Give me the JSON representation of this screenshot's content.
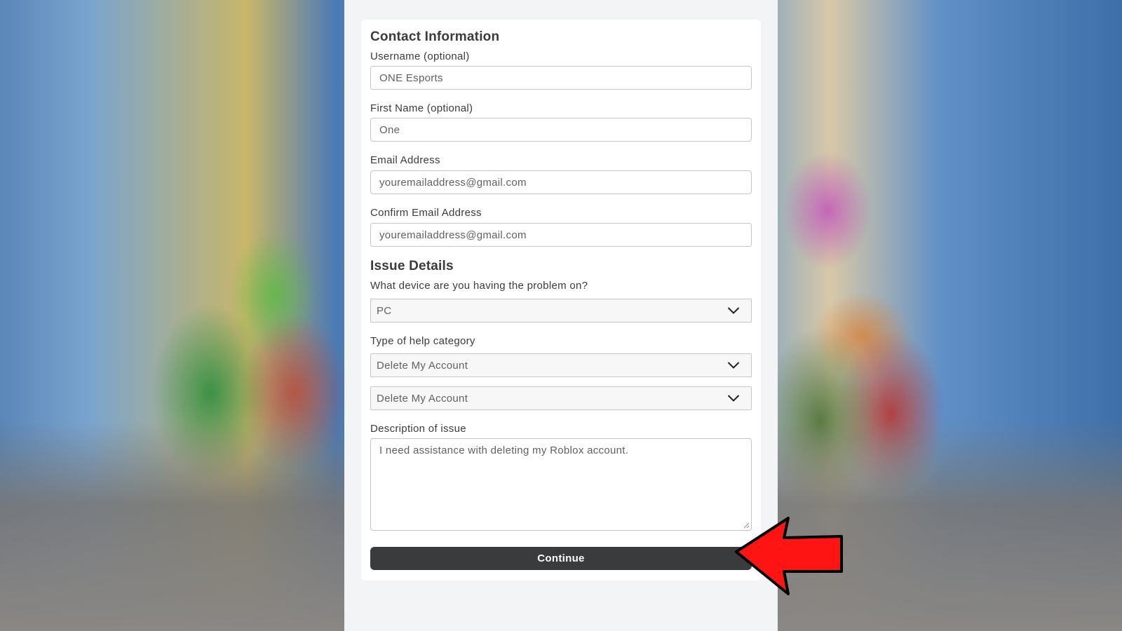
{
  "contact": {
    "title": "Contact Information",
    "username_label": "Username (optional)",
    "username_value": "ONE Esports",
    "firstname_label": "First Name (optional)",
    "firstname_value": "One",
    "email_label": "Email Address",
    "email_value": "youremailaddress@gmail.com",
    "confirm_email_label": "Confirm Email Address",
    "confirm_email_value": "youremailaddress@gmail.com"
  },
  "issue": {
    "title": "Issue Details",
    "device_label": "What device are you having the problem on?",
    "device_value": "PC",
    "category_label": "Type of help category",
    "category_value": "Delete My Account",
    "subcategory_value": "Delete My Account",
    "description_label": "Description of issue",
    "description_value": "I need assistance with deleting my Roblox account."
  },
  "actions": {
    "continue_label": "Continue"
  },
  "colors": {
    "button_bg": "#393b3d",
    "pointer_arrow": "#ff0000"
  },
  "icons": {
    "dropdown": "chevron-down-icon",
    "resize": "resize-handle-icon",
    "pointer": "red-arrow-icon"
  }
}
